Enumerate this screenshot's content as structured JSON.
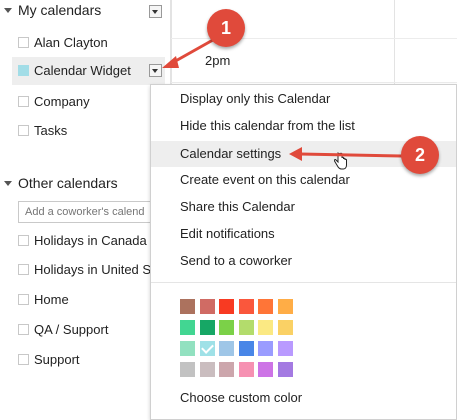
{
  "sidebar": {
    "my_calendars": {
      "header": "My calendars",
      "items": [
        {
          "label": "Alan Clayton",
          "color": "#ffffff"
        },
        {
          "label": "Calendar Widget",
          "color": "#a2dde7"
        },
        {
          "label": "Company",
          "color": "#ffffff"
        },
        {
          "label": "Tasks",
          "color": "#ffffff"
        }
      ]
    },
    "other_calendars": {
      "header": "Other calendars",
      "coworker_placeholder": "Add a coworker's calendar",
      "items": [
        {
          "label": "Holidays in Canada"
        },
        {
          "label": "Holidays in United St..."
        },
        {
          "label": "Home"
        },
        {
          "label": "QA / Support"
        },
        {
          "label": "Support"
        }
      ]
    }
  },
  "grid": {
    "time_label": "2pm"
  },
  "menu": {
    "items": [
      "Display only this Calendar",
      "Hide this calendar from the list",
      "Calendar settings",
      "Create event on this calendar",
      "Share this Calendar",
      "Edit notifications",
      "Send to a coworker"
    ],
    "custom_color": "Choose custom color",
    "palette": [
      [
        "#ac725e",
        "#d06b64",
        "#f83a22",
        "#fa573c",
        "#ff7537",
        "#ffad46"
      ],
      [
        "#42d692",
        "#16a765",
        "#7bd148",
        "#b3dc6c",
        "#fbe983",
        "#fad165"
      ],
      [
        "#92e1c0",
        "#9fe1e7",
        "#9fc6e7",
        "#4986e7",
        "#9a9cff",
        "#b99aff"
      ],
      [
        "#c2c2c2",
        "#cabdbf",
        "#cca6ac",
        "#f691b2",
        "#cd74e6",
        "#a47ae2"
      ]
    ],
    "selected_swatch": "#9fe1e7"
  },
  "annotations": {
    "step1": "1",
    "step2": "2",
    "color": "#e04a3b"
  }
}
